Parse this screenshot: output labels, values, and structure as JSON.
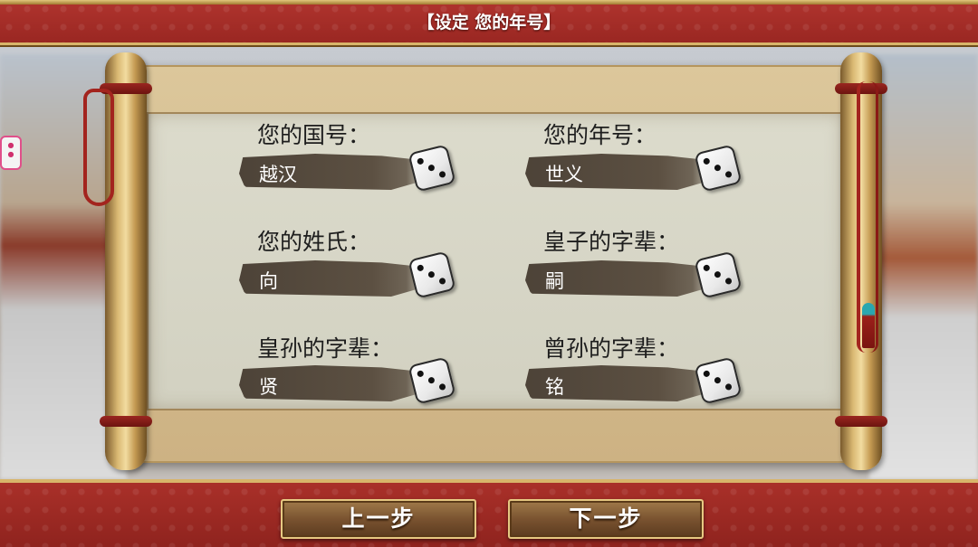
{
  "header": {
    "title": "【设定 您的年号】"
  },
  "fields": [
    {
      "label": "您的国号：",
      "value": "越汉"
    },
    {
      "label": "您的年号：",
      "value": "世义"
    },
    {
      "label": "您的姓氏：",
      "value": "向"
    },
    {
      "label": "皇子的字辈：",
      "value": "嗣"
    },
    {
      "label": "皇孙的字辈：",
      "value": "贤"
    },
    {
      "label": "曾孙的字辈：",
      "value": "铭"
    }
  ],
  "footer": {
    "prev_label": "上一步",
    "next_label": "下一步"
  },
  "colors": {
    "banner": "#a93029",
    "gold": "#d8b56a",
    "ink": "#5c5042"
  }
}
